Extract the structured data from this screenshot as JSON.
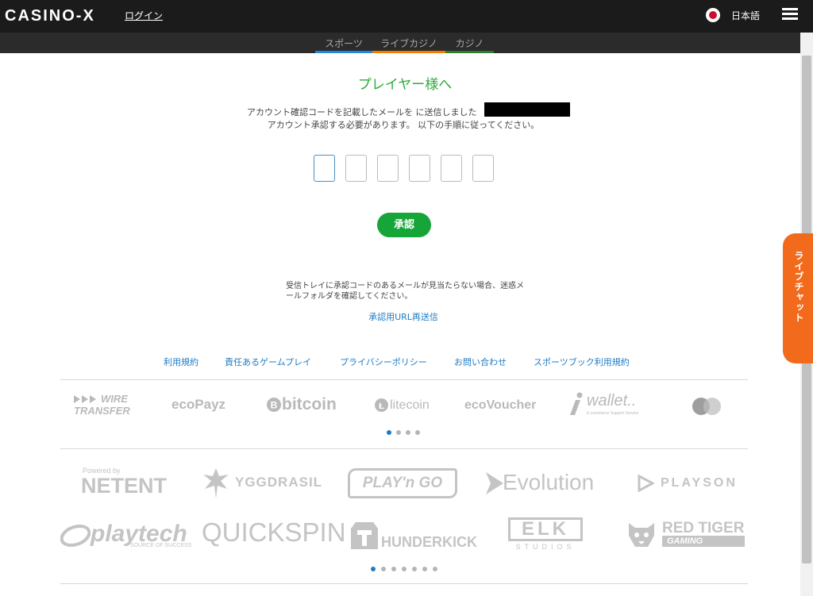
{
  "header": {
    "logo_text": "CASINO-X",
    "login_label": "ログイン",
    "language_label": "日本語",
    "menu_icon": "hamburger-icon"
  },
  "subnav": {
    "tabs": [
      {
        "label": "スポーツ",
        "color": "#1e88e5"
      },
      {
        "label": "ライブカジノ",
        "color": "#f57c00"
      },
      {
        "label": "カジノ",
        "color": "#2e7d32"
      }
    ]
  },
  "main": {
    "greeting": "プレイヤー様へ",
    "message_line1": "アカウント確認コードを記載したメールを に送信しました",
    "message_line2": "アカウント承認する必要があります。 以下の手順に従ってください。",
    "confirm_label": "承認",
    "note_text": "受信トレイに承認コードのあるメールが見当たらない場合、迷惑メールフォルダを確認してください。",
    "resend_link": "承認用URL再送信",
    "accent_green": "#16a538",
    "link_blue": "#1f7bc4"
  },
  "livechat": {
    "label": "ライブチャット",
    "color": "#f26b1d"
  },
  "footer": {
    "links": [
      "利用規約",
      "責任あるゲームプレイ",
      "プライバシーポリシー",
      "お問い合わせ",
      "スポーツブック利用規約"
    ],
    "payments": {
      "wire_line1": "WIRE",
      "wire_line2": "TRANSFER",
      "ecopayz": "ecoPayz",
      "bitcoin": "bitcoin",
      "litecoin": "litecoin",
      "ecovoucher": "ecoVoucher",
      "iwallet": "wallet..",
      "iwallet_tagline": "E-commerce Support Service"
    },
    "providers": {
      "netent_powered": "Powered by",
      "netent": "NETENT",
      "yggdrasil": "YGGDRASIL",
      "playngo": "PLAY'n GO",
      "evolution": "Evolution",
      "playson": "PLAYSON",
      "playtech": "playtech",
      "playtech_tagline": "SOURCE OF SUCCESS",
      "quickspin": "QUICKSPIN",
      "thunderkick": "HUNDERKICK",
      "elk": "ELK",
      "elk_sub": "STUDIOS",
      "redtiger_line1": "RED TIGER",
      "redtiger_line2": "GAMING"
    }
  }
}
